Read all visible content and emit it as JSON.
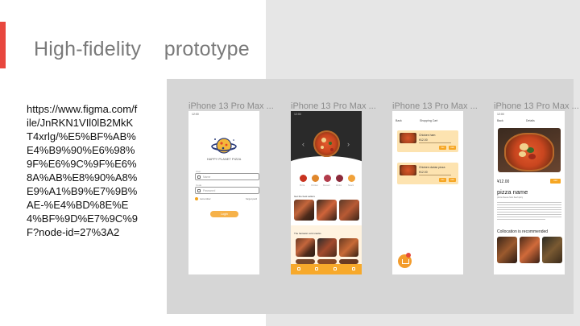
{
  "slide": {
    "title": "High-fidelity    prototype",
    "figma_link": "https://www.figma.com/file/JnRKN1VIl0lB2MkKT4xrlg/%E5%BF%AB%E4%B9%90%E6%98%9F%E6%9C%9F%E6%8A%AB%E8%90%A8%E9%A1%B9%E7%9B%AE-%E4%BD%8E%E4%BF%9D%E7%9C%9F?node-id=27%3A2",
    "accent_color": "#e8473e"
  },
  "phones": [
    {
      "label": "iPhone 13 Pro Max ...",
      "status_time": "12:00",
      "app_name": "HAPPY PLANET PIZZA",
      "username_label": "User",
      "username_placeholder": "Name",
      "password_label": "Code",
      "password_placeholder": "Password",
      "remember_label": "remember",
      "forgot_label": "forget pwd",
      "login_button": "Login"
    },
    {
      "label": "iPhone 13 Pro Max ...",
      "status_time": "12:00",
      "categories": [
        "Pizza",
        "Chicken",
        "Dessert",
        "Drinks",
        "Snack"
      ],
      "best_sellers_heading": "Get the best sellers",
      "fantastic_heading": "The fantastic cold snacks"
    },
    {
      "label": "iPhone 13 Pro Max ...",
      "back_label": "Back",
      "page_title": "Shopping Cart",
      "items": [
        {
          "name": "Chicken ham",
          "price": "¥12.00",
          "minus": "Del",
          "plus": "Add"
        },
        {
          "name": "Chicken durian pizza",
          "price": "¥12.00",
          "minus": "Del",
          "plus": "Add"
        }
      ]
    },
    {
      "label": "iPhone 13 Pro Max ...",
      "status_time": "12:00",
      "back_label": "Back",
      "page_title": "Details",
      "price": "¥12.00",
      "add_button": "Add",
      "product_name": "pizza name",
      "tags": "pizza  cheese  ham  beef  spicy",
      "recommend_heading": "Collocation is recommended"
    }
  ]
}
